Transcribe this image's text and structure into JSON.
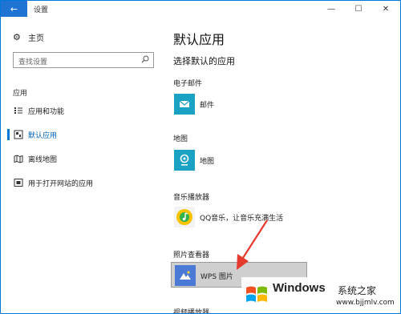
{
  "window": {
    "title": "设置",
    "back_glyph": "←",
    "min_glyph": "—",
    "max_glyph": "☐",
    "close_glyph": "✕"
  },
  "sidebar": {
    "home_label": "主页",
    "search_placeholder": "查找设置",
    "section_label": "应用",
    "items": [
      {
        "label": "应用和功能",
        "icon": "list-icon"
      },
      {
        "label": "默认应用",
        "icon": "default-apps-icon",
        "active": true
      },
      {
        "label": "离线地图",
        "icon": "map-icon"
      },
      {
        "label": "用于打开网站的应用",
        "icon": "web-apps-icon"
      }
    ]
  },
  "main": {
    "title": "默认应用",
    "subtitle": "选择默认的应用",
    "categories": [
      {
        "label": "电子邮件",
        "app": "邮件"
      },
      {
        "label": "地图",
        "app": "地图"
      },
      {
        "label": "音乐播放器",
        "app": "QQ音乐，让音乐充满生活"
      },
      {
        "label": "照片查看器",
        "app": "WPS 图片"
      },
      {
        "label": "视频播放器"
      }
    ]
  },
  "watermark": {
    "brand": "Windows",
    "cn": "系统之家",
    "url": "www.bjjmlv.com"
  },
  "colors": {
    "accent": "#0078d7",
    "tile": "#1aa2c4",
    "arrow": "#e63a2e"
  }
}
